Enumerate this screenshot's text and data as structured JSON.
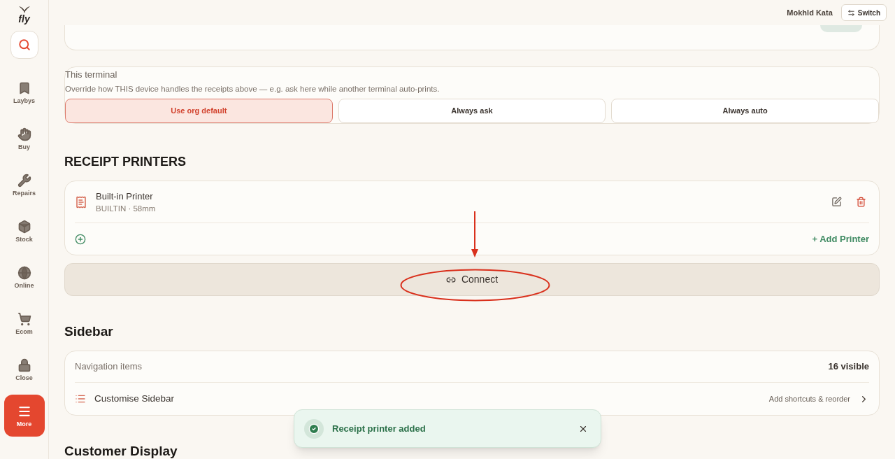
{
  "app": {
    "logo": "fly"
  },
  "nav": [
    {
      "label": "Laybys",
      "selected": false
    },
    {
      "label": "Buy",
      "selected": false
    },
    {
      "label": "Repairs",
      "selected": false
    },
    {
      "label": "Stock",
      "selected": false
    },
    {
      "label": "Online",
      "selected": false
    },
    {
      "label": "Ecom",
      "selected": false
    },
    {
      "label": "Close",
      "selected": false
    },
    {
      "label": "More",
      "selected": true
    }
  ],
  "header": {
    "user": "Mokhld Kata",
    "switch_label": "Switch"
  },
  "terminal": {
    "title": "This terminal",
    "description": "Override how THIS device handles the receipts above — e.g. ask here while another terminal auto-prints.",
    "options": [
      {
        "label": "Use org default",
        "selected": true
      },
      {
        "label": "Always ask",
        "selected": false
      },
      {
        "label": "Always auto",
        "selected": false
      }
    ]
  },
  "printers": {
    "heading": "RECEIPT PRINTERS",
    "items": [
      {
        "name": "Built-in Printer",
        "detail": "BUILTIN · 58mm"
      }
    ],
    "add_label": "+ Add Printer",
    "connect_label": "Connect"
  },
  "sidebar_section": {
    "heading": "Sidebar",
    "nav_label": "Navigation items",
    "nav_count": "16 visible",
    "customise_label": "Customise Sidebar",
    "customise_hint": "Add shortcuts & reorder"
  },
  "next_heading": "Customer Display",
  "toast": {
    "message": "Receipt printer added"
  }
}
